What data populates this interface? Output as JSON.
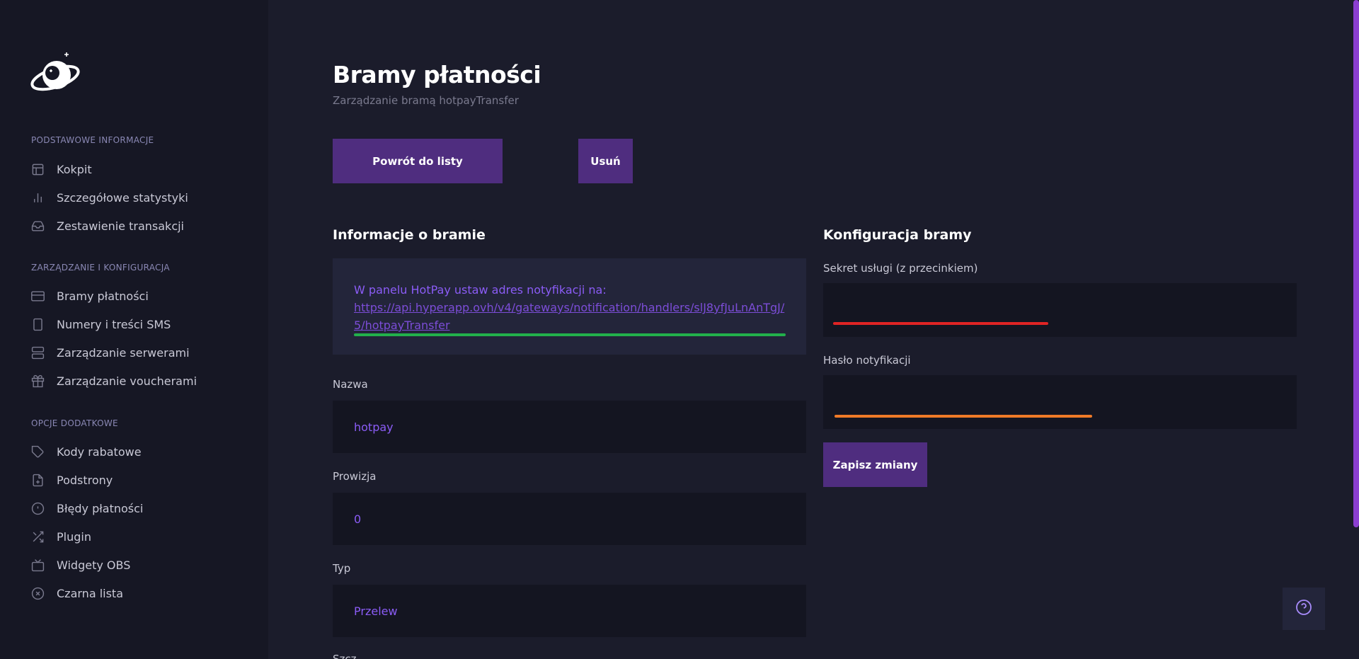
{
  "sidebar": {
    "sections": [
      {
        "title": "PODSTAWOWE INFORMACJE",
        "items": [
          {
            "label": "Kokpit",
            "icon": "layout-icon"
          },
          {
            "label": "Szczegółowe statystyki",
            "icon": "bar-chart-icon"
          },
          {
            "label": "Zestawienie transakcji",
            "icon": "inbox-icon"
          }
        ]
      },
      {
        "title": "ZARZĄDZANIE I KONFIGURACJA",
        "items": [
          {
            "label": "Bramy płatności",
            "icon": "credit-card-icon"
          },
          {
            "label": "Numery i treści SMS",
            "icon": "smartphone-icon"
          },
          {
            "label": "Zarządzanie serwerami",
            "icon": "server-icon"
          },
          {
            "label": "Zarządzanie voucherami",
            "icon": "gift-icon"
          }
        ]
      },
      {
        "title": "OPCJE DODATKOWE",
        "items": [
          {
            "label": "Kody rabatowe",
            "icon": "tag-icon"
          },
          {
            "label": "Podstrony",
            "icon": "file-plus-icon"
          },
          {
            "label": "Błędy płatności",
            "icon": "alert-circle-icon"
          },
          {
            "label": "Plugin",
            "icon": "shuffle-icon"
          },
          {
            "label": "Widgety OBS",
            "icon": "tv-icon"
          },
          {
            "label": "Czarna lista",
            "icon": "x-circle-icon"
          }
        ]
      }
    ]
  },
  "header": {
    "title": "Bramy płatności",
    "subtitle": "Zarządzanie bramą hotpayTransfer"
  },
  "actions": {
    "back_label": "Powrót do listy",
    "delete_label": "Usuń"
  },
  "gateway_info": {
    "heading": "Informacje o bramie",
    "notice_text": "W panelu HotPay ustaw adres notyfikacji na:",
    "notice_link": "https://api.hyperapp.ovh/v4/gateways/notification/handlers/slJ8yfJuLnAnTgJ/5/hotpayTransfer",
    "fields": {
      "name_label": "Nazwa",
      "name_value": "hotpay",
      "commission_label": "Prowizja",
      "commission_value": "0",
      "type_label": "Typ",
      "type_value": "Przelew",
      "next_label": "Szcz..."
    }
  },
  "gateway_config": {
    "heading": "Konfiguracja bramy",
    "secret_label": "Sekret usługi (z przecinkiem)",
    "secret_value": "",
    "password_label": "Hasło notyfikacji",
    "password_value": "",
    "save_label": "Zapisz zmiany"
  },
  "colors": {
    "accent": "#4f2d7f",
    "link": "#7c4dd8",
    "redacted_green": "#22b04b",
    "redacted_red": "#e02424",
    "redacted_orange": "#f07a28"
  }
}
